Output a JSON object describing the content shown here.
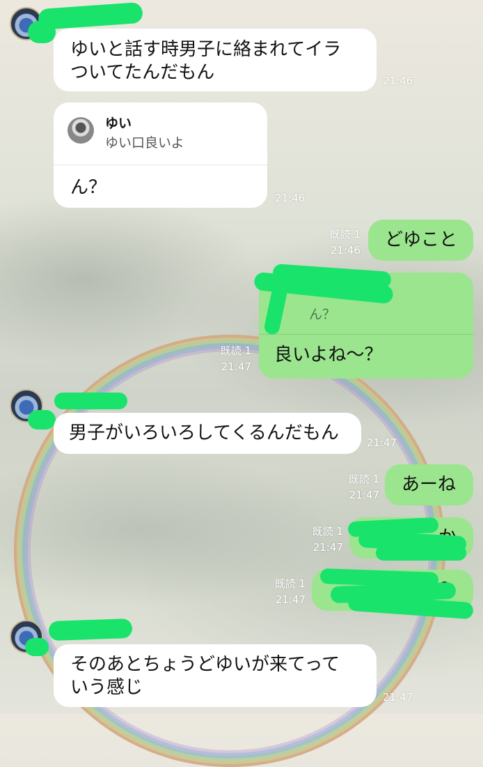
{
  "chat": {
    "messages": [
      {
        "text": "ゆいと話す時男子に絡まれてイラ\nついてたんだもん",
        "time": "21:46"
      },
      {
        "quote_name": "ゆい",
        "quote_text": "ゆい口良いよ",
        "text": "ん？",
        "time": "21:46"
      },
      {
        "text": "どゆこと",
        "read": "既読 1",
        "time": "21:46"
      },
      {
        "quote_text": "ん？",
        "text": "良いよね〜？",
        "read": "既読 1",
        "time": "21:47"
      },
      {
        "text": "男子がいろいろしてくるんだもん",
        "time": "21:47"
      },
      {
        "text": "あーね",
        "read": "既読 1",
        "time": "21:47"
      },
      {
        "text": "か",
        "read": "既読 1",
        "time": "21:47"
      },
      {
        "text": "？",
        "read": "既読 1",
        "time": "21:47"
      },
      {
        "text": "そのあとちょうどゆいが来てって\nいう感じ",
        "time": "21:47"
      }
    ]
  },
  "colors": {
    "incoming_bubble": "#ffffff",
    "outgoing_bubble": "#9ae58e",
    "redaction": "#19e36b"
  },
  "icons": [
    "contact-avatar",
    "quoted-avatar"
  ]
}
